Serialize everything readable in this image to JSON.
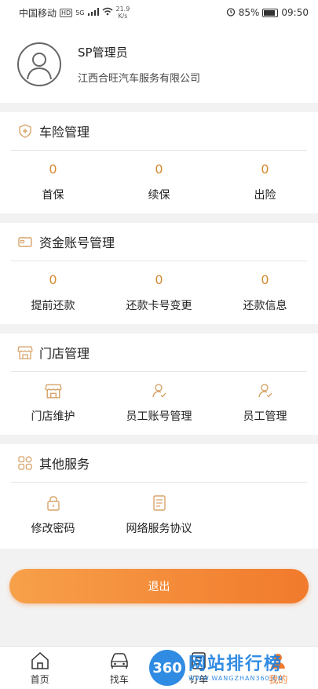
{
  "statusbar": {
    "carrier": "中国移动",
    "net_badge": "HD",
    "signal": "5G",
    "speed_value": "21.9",
    "speed_unit": "K/s",
    "battery": "85%",
    "time": "09:50"
  },
  "profile": {
    "name": "SP管理员",
    "company": "江西合旺汽车服务有限公司"
  },
  "sections": {
    "insurance": {
      "title": "车险管理",
      "items": [
        {
          "value": "0",
          "label": "首保"
        },
        {
          "value": "0",
          "label": "续保"
        },
        {
          "value": "0",
          "label": "出险"
        }
      ]
    },
    "funds": {
      "title": "资金账号管理",
      "items": [
        {
          "value": "0",
          "label": "提前还款"
        },
        {
          "value": "0",
          "label": "还款卡号变更"
        },
        {
          "value": "0",
          "label": "还款信息"
        }
      ]
    },
    "store": {
      "title": "门店管理",
      "items": [
        {
          "icon": "store-icon",
          "label": "门店维护"
        },
        {
          "icon": "user-check-icon",
          "label": "员工账号管理"
        },
        {
          "icon": "user-check-icon",
          "label": "员工管理"
        }
      ]
    },
    "other": {
      "title": "其他服务",
      "items": [
        {
          "icon": "lock-icon",
          "label": "修改密码"
        },
        {
          "icon": "document-icon",
          "label": "网络服务协议"
        }
      ]
    }
  },
  "logout_label": "退出",
  "tabbar": [
    {
      "label": "首页",
      "icon": "home-icon"
    },
    {
      "label": "找车",
      "icon": "car-icon"
    },
    {
      "label": "订单",
      "icon": "order-icon"
    },
    {
      "label": "我的",
      "icon": "person-icon"
    }
  ],
  "watermark": {
    "logo": "360",
    "text": "网站排行榜",
    "url": "WWW.WANGZHAN360.CN"
  },
  "colors": {
    "accent": "#f17a2c",
    "number": "#d88a2f",
    "icon": "#d8a46a"
  }
}
